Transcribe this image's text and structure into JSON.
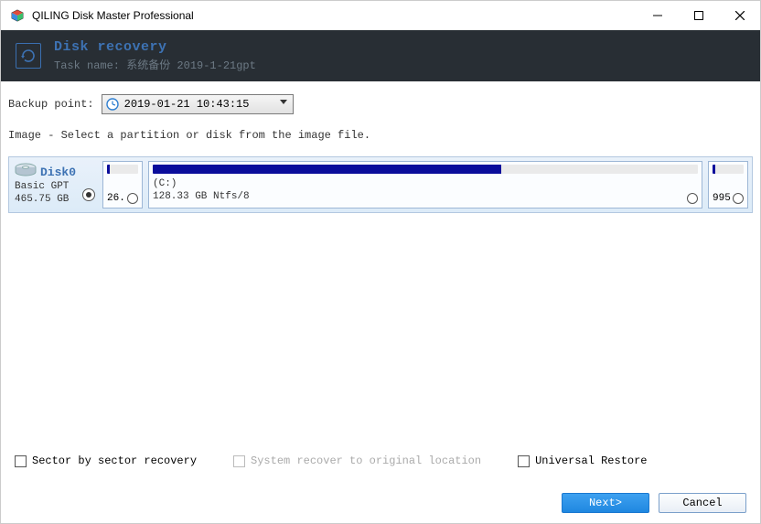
{
  "window": {
    "title": "QILING Disk Master Professional"
  },
  "header": {
    "title": "Disk recovery",
    "subtitle_prefix": "Task name:",
    "subtitle_value": "系统备份 2019-1-21gpt"
  },
  "backup_point": {
    "label": "Backup point:",
    "selected": "2019-01-21 10:43:15"
  },
  "instruction": "Image - Select a partition or disk from the image file.",
  "disk": {
    "name": "Disk0",
    "type": "Basic GPT",
    "size": "465.75 GB",
    "selected": true,
    "partitions": [
      {
        "label_top": "",
        "label_bottom": "26.",
        "drive": "",
        "info": ""
      },
      {
        "label_top": "",
        "label_bottom": "",
        "drive": "(C:)",
        "info": "128.33 GB Ntfs/8"
      },
      {
        "label_top": "",
        "label_bottom": "995.",
        "drive": "",
        "info": ""
      }
    ]
  },
  "options": {
    "sector_by_sector": "Sector by sector recovery",
    "system_recover": "System recover to original location",
    "universal_restore": "Universal Restore"
  },
  "buttons": {
    "next": "Next>",
    "cancel": "Cancel"
  }
}
